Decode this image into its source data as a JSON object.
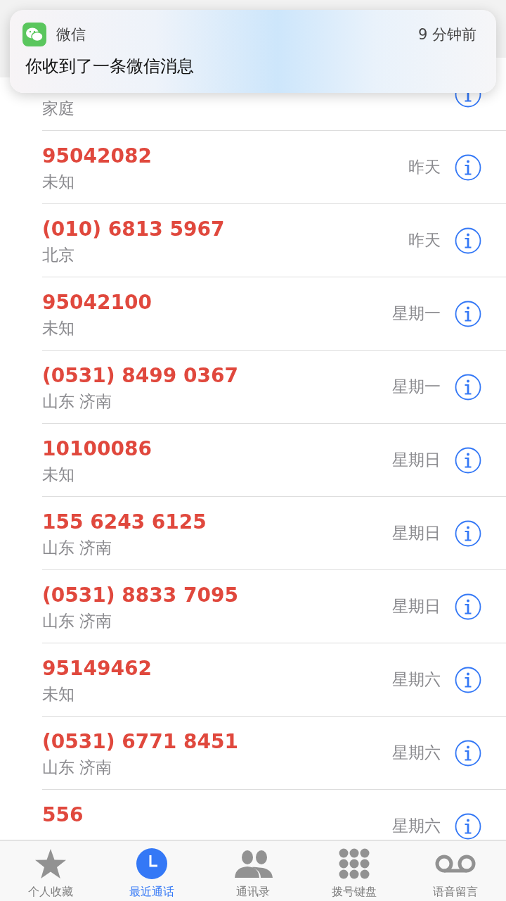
{
  "notification": {
    "app": "微信",
    "time": "9 分钟前",
    "message": "你收到了一条微信消息"
  },
  "calls": [
    {
      "subtitle": "家庭"
    },
    {
      "number": "95042082",
      "subtitle": "未知",
      "date": "昨天"
    },
    {
      "number": "(010) 6813 5967",
      "subtitle": "北京",
      "date": "昨天"
    },
    {
      "number": "95042100",
      "subtitle": "未知",
      "date": "星期一"
    },
    {
      "number": "(0531) 8499 0367",
      "subtitle": "山东 济南",
      "date": "星期一"
    },
    {
      "number": "10100086",
      "subtitle": "未知",
      "date": "星期日"
    },
    {
      "number": "155 6243 6125",
      "subtitle": "山东 济南",
      "date": "星期日"
    },
    {
      "number": "(0531) 8833 7095",
      "subtitle": "山东 济南",
      "date": "星期日"
    },
    {
      "number": "95149462",
      "subtitle": "未知",
      "date": "星期六"
    },
    {
      "number": "(0531) 6771 8451",
      "subtitle": "山东 济南",
      "date": "星期六"
    },
    {
      "number": "556",
      "date": "星期六"
    }
  ],
  "tabs": [
    {
      "label": "个人收藏",
      "selected": false
    },
    {
      "label": "最近通话",
      "selected": true
    },
    {
      "label": "通讯录",
      "selected": false
    },
    {
      "label": "拨号键盘",
      "selected": false
    },
    {
      "label": "语音留言",
      "selected": false
    }
  ]
}
